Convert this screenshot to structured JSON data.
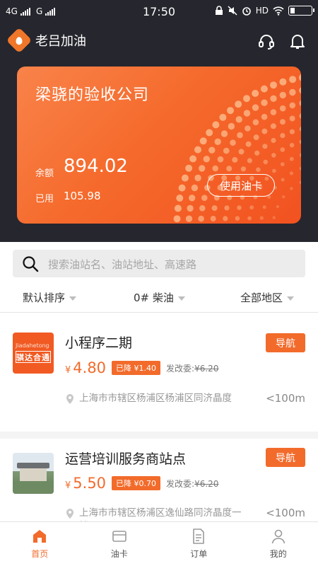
{
  "status_bar": {
    "left": "4G \u0000G",
    "carrier1": "4G",
    "carrier2": "G",
    "time": "17:50",
    "hd": "HD"
  },
  "header": {
    "brand_name": "老吕加油"
  },
  "card": {
    "company": "梁骁的验收公司",
    "balance_label": "余额",
    "balance": "894.02",
    "used_label": "已用",
    "used": "105.98",
    "use_button": "使用油卡",
    "colors": {
      "start": "#f9834a",
      "end": "#f25220"
    }
  },
  "search": {
    "placeholder": "搜索油站名、油站地址、高速路"
  },
  "filters": [
    {
      "label": "默认排序"
    },
    {
      "label": "0# 柴油"
    },
    {
      "label": "全部地区"
    }
  ],
  "stations": [
    {
      "name": "小程序二期",
      "nav_label": "导航",
      "currency": "¥",
      "price": "4.80",
      "drop_label": "已降 ¥1.40",
      "ref_label": "发改委:",
      "ref_price": "¥6.20",
      "address": "上海市市辖区杨浦区杨浦区同济晶度",
      "distance": "<100m",
      "logo_text": "骐达合通",
      "logo_subtext": "Jiadahetong"
    },
    {
      "name": "运营培训服务商站点",
      "nav_label": "导航",
      "currency": "¥",
      "price": "5.50",
      "drop_label": "已降 ¥0.70",
      "ref_label": "发改委:",
      "ref_price": "¥6.20",
      "address": "上海市市辖区杨浦区逸仙路同济晶度一楼",
      "distance": "<100m"
    }
  ],
  "tabbar": [
    {
      "label": "首页",
      "icon": "home-icon",
      "active": true
    },
    {
      "label": "油卡",
      "icon": "card-icon",
      "active": false
    },
    {
      "label": "订单",
      "icon": "order-icon",
      "active": false
    },
    {
      "label": "我的",
      "icon": "profile-icon",
      "active": false
    }
  ],
  "accent_color": "#f26b2b"
}
